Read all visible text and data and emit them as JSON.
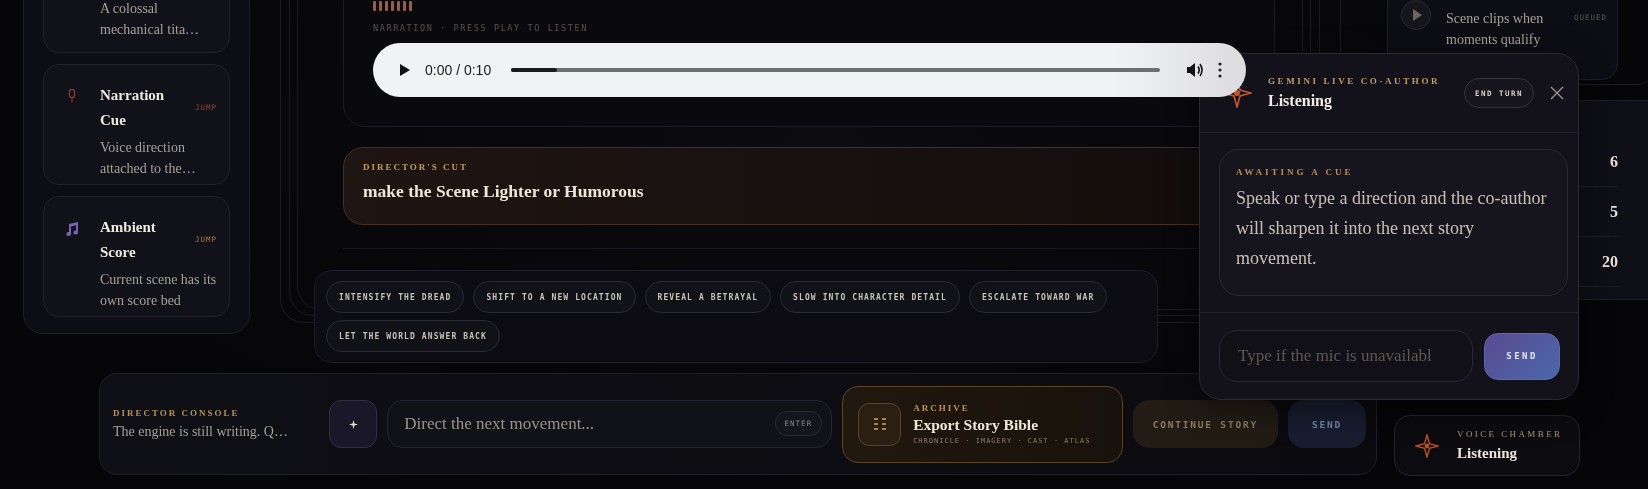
{
  "sidebar": {
    "cards": [
      {
        "description": "A colossal mechanical tita…"
      },
      {
        "kind": "narration",
        "title": "Narration Cue",
        "action": "JUMP",
        "description": "Voice direction attached to the…"
      },
      {
        "kind": "score",
        "title": "Ambient Score",
        "action": "JUMP",
        "description": "Current scene has its own score bed"
      }
    ]
  },
  "narration": {
    "caption": "NARRATION · PRESS PLAY TO LISTEN",
    "player": {
      "time": "0:00 / 0:10",
      "level": 0.07
    }
  },
  "directors_cut": {
    "label": "DIRECTOR'S CUT",
    "text": "make the Scene Lighter or Humorous"
  },
  "suggestions": [
    "INTENSIFY THE DREAD",
    "SHIFT TO A NEW LOCATION",
    "REVEAL A BETRAYAL",
    "SLOW INTO CHARACTER DETAIL",
    "ESCALATE TOWARD WAR",
    "LET THE WORLD ANSWER BACK"
  ],
  "console": {
    "label": "DIRECTOR CONSOLE",
    "status": "The engine is still writing. Q…",
    "input": {
      "placeholder": "Direct the next movement...",
      "key_hint": "ENTER"
    },
    "archive": {
      "label": "ARCHIVE",
      "title": "Export Story Bible",
      "subtitle": "CHRONICLE · IMAGERY · CAST · ATLAS"
    },
    "buttons": [
      {
        "kind": "continue",
        "label": "CONTINUE STORY",
        "disabled": true
      },
      {
        "kind": "send",
        "label": "SEND",
        "disabled": true
      }
    ]
  },
  "clips": {
    "text": "Scene clips when moments qualify",
    "status": "QUEUED"
  },
  "ledger": {
    "values": [
      "6",
      "5",
      "20"
    ]
  },
  "co_author": {
    "label": "GEMINI LIVE CO-AUTHOR",
    "status": "Listening",
    "end_turn": "END TURN",
    "prompt": {
      "label": "AWAITING A CUE",
      "text": "Speak or type a direction and the co-author will sharpen it into the next story movement."
    },
    "input": {
      "placeholder": "Type if the mic is unavailabl"
    },
    "send": "SEND"
  },
  "voice_chamber": {
    "label": "VOICE CHAMBER",
    "status": "Listening"
  }
}
